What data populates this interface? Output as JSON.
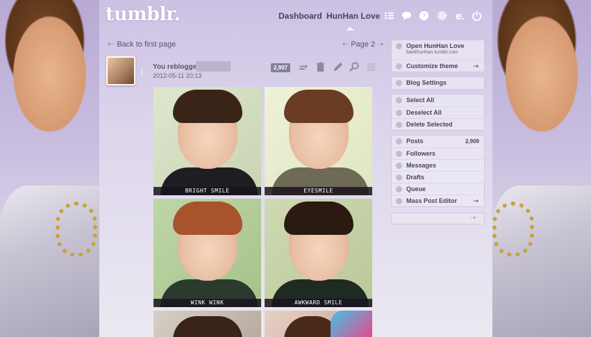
{
  "header": {
    "logo": "tumblr.",
    "nav": [
      "Dashboard",
      "HunHan Love"
    ],
    "icons": [
      "list-icon",
      "chat-icon",
      "globe-icon",
      "gear-icon",
      "e-icon",
      "power-icon"
    ]
  },
  "pagination": {
    "back_label": "Back to first page",
    "page_label": "Page 2"
  },
  "post": {
    "reblog_text": "You reblogged",
    "date": "2012-05-11 20:13",
    "notes": "2,907",
    "photos": [
      {
        "caption": "BRIGHT SMILE"
      },
      {
        "caption": "EYESMILE"
      },
      {
        "caption": "WINK WINK"
      },
      {
        "caption": "AWKWARD SMILE"
      },
      {
        "caption": ""
      },
      {
        "caption": ""
      }
    ]
  },
  "sidebar": {
    "open_blog": "Open HunHan Love",
    "blog_url": "baekhunhan.tumblr.com",
    "customize": "Customize theme",
    "blog_settings": "Blog Settings",
    "select_all": "Select All",
    "deselect_all": "Deselect All",
    "delete_selected": "Delete Selected",
    "posts": "Posts",
    "posts_count": "2,909",
    "followers": "Followers",
    "messages": "Messages",
    "drafts": "Drafts",
    "queue": "Queue",
    "mass_post_editor": "Mass Post Editor"
  },
  "colors": {
    "panel_top": "#cdc1e4",
    "panel_bottom": "#ece9f1",
    "text": "#4a4356",
    "caption_bg": "#19141e"
  }
}
